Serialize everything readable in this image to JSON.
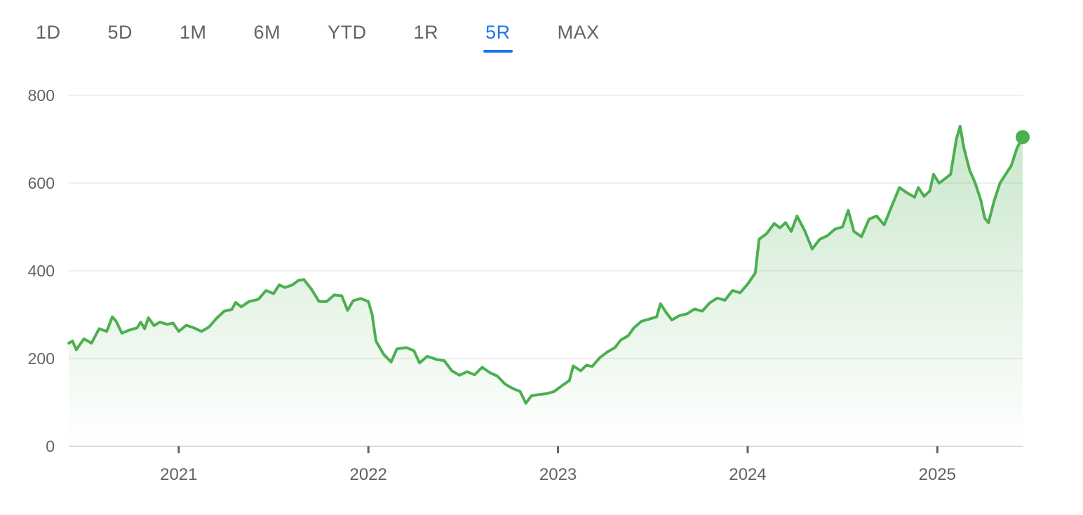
{
  "range_selector": {
    "tabs": [
      {
        "label": "1D",
        "active": false
      },
      {
        "label": "5D",
        "active": false
      },
      {
        "label": "1M",
        "active": false
      },
      {
        "label": "6M",
        "active": false
      },
      {
        "label": "YTD",
        "active": false
      },
      {
        "label": "1R",
        "active": false
      },
      {
        "label": "5R",
        "active": true
      },
      {
        "label": "MAX",
        "active": false
      }
    ],
    "active_color": "#1a73e8",
    "inactive_color": "#5f6368"
  },
  "chart_data": {
    "type": "area",
    "title": "",
    "xlabel": "",
    "ylabel": "",
    "ylim": [
      0,
      800
    ],
    "yticks": [
      0,
      200,
      400,
      600,
      800
    ],
    "xlim": [
      2020.42,
      2025.45
    ],
    "xticks": [
      {
        "value": 2021,
        "label": "2021"
      },
      {
        "value": 2022,
        "label": "2022"
      },
      {
        "value": 2023,
        "label": "2023"
      },
      {
        "value": 2024,
        "label": "2024"
      },
      {
        "value": 2025,
        "label": "2025"
      }
    ],
    "grid": true,
    "line_color": "#4caf50",
    "fill_color": "#4caf50",
    "series": [
      {
        "points": [
          [
            2020.42,
            235
          ],
          [
            2020.44,
            240
          ],
          [
            2020.46,
            220
          ],
          [
            2020.5,
            245
          ],
          [
            2020.54,
            235
          ],
          [
            2020.58,
            268
          ],
          [
            2020.62,
            262
          ],
          [
            2020.65,
            295
          ],
          [
            2020.67,
            285
          ],
          [
            2020.7,
            258
          ],
          [
            2020.74,
            265
          ],
          [
            2020.78,
            270
          ],
          [
            2020.8,
            283
          ],
          [
            2020.82,
            268
          ],
          [
            2020.84,
            293
          ],
          [
            2020.87,
            275
          ],
          [
            2020.9,
            283
          ],
          [
            2020.94,
            278
          ],
          [
            2020.97,
            281
          ],
          [
            2021.0,
            262
          ],
          [
            2021.04,
            276
          ],
          [
            2021.08,
            270
          ],
          [
            2021.12,
            262
          ],
          [
            2021.16,
            272
          ],
          [
            2021.2,
            292
          ],
          [
            2021.24,
            308
          ],
          [
            2021.28,
            312
          ],
          [
            2021.3,
            328
          ],
          [
            2021.33,
            318
          ],
          [
            2021.37,
            330
          ],
          [
            2021.42,
            335
          ],
          [
            2021.46,
            355
          ],
          [
            2021.5,
            348
          ],
          [
            2021.53,
            368
          ],
          [
            2021.56,
            362
          ],
          [
            2021.6,
            368
          ],
          [
            2021.63,
            378
          ],
          [
            2021.66,
            380
          ],
          [
            2021.7,
            358
          ],
          [
            2021.74,
            330
          ],
          [
            2021.78,
            330
          ],
          [
            2021.82,
            345
          ],
          [
            2021.86,
            343
          ],
          [
            2021.89,
            310
          ],
          [
            2021.92,
            332
          ],
          [
            2021.96,
            337
          ],
          [
            2022.0,
            330
          ],
          [
            2022.02,
            300
          ],
          [
            2022.04,
            240
          ],
          [
            2022.08,
            210
          ],
          [
            2022.12,
            192
          ],
          [
            2022.15,
            222
          ],
          [
            2022.2,
            225
          ],
          [
            2022.24,
            218
          ],
          [
            2022.27,
            190
          ],
          [
            2022.31,
            205
          ],
          [
            2022.36,
            198
          ],
          [
            2022.4,
            195
          ],
          [
            2022.44,
            172
          ],
          [
            2022.48,
            162
          ],
          [
            2022.52,
            170
          ],
          [
            2022.56,
            163
          ],
          [
            2022.6,
            180
          ],
          [
            2022.64,
            168
          ],
          [
            2022.68,
            160
          ],
          [
            2022.72,
            142
          ],
          [
            2022.76,
            132
          ],
          [
            2022.8,
            125
          ],
          [
            2022.83,
            98
          ],
          [
            2022.86,
            115
          ],
          [
            2022.9,
            118
          ],
          [
            2022.94,
            120
          ],
          [
            2022.98,
            125
          ],
          [
            2023.02,
            138
          ],
          [
            2023.06,
            150
          ],
          [
            2023.08,
            183
          ],
          [
            2023.12,
            172
          ],
          [
            2023.15,
            185
          ],
          [
            2023.18,
            182
          ],
          [
            2023.22,
            202
          ],
          [
            2023.26,
            215
          ],
          [
            2023.3,
            225
          ],
          [
            2023.33,
            242
          ],
          [
            2023.37,
            252
          ],
          [
            2023.4,
            270
          ],
          [
            2023.44,
            285
          ],
          [
            2023.48,
            290
          ],
          [
            2023.52,
            295
          ],
          [
            2023.54,
            325
          ],
          [
            2023.57,
            305
          ],
          [
            2023.6,
            288
          ],
          [
            2023.64,
            298
          ],
          [
            2023.68,
            302
          ],
          [
            2023.72,
            313
          ],
          [
            2023.76,
            308
          ],
          [
            2023.8,
            327
          ],
          [
            2023.84,
            338
          ],
          [
            2023.88,
            333
          ],
          [
            2023.92,
            355
          ],
          [
            2023.96,
            350
          ],
          [
            2024.0,
            370
          ],
          [
            2024.04,
            395
          ],
          [
            2024.06,
            472
          ],
          [
            2024.1,
            485
          ],
          [
            2024.14,
            508
          ],
          [
            2024.17,
            498
          ],
          [
            2024.2,
            510
          ],
          [
            2024.23,
            490
          ],
          [
            2024.26,
            525
          ],
          [
            2024.3,
            492
          ],
          [
            2024.34,
            450
          ],
          [
            2024.38,
            472
          ],
          [
            2024.42,
            480
          ],
          [
            2024.46,
            495
          ],
          [
            2024.5,
            500
          ],
          [
            2024.53,
            538
          ],
          [
            2024.56,
            490
          ],
          [
            2024.6,
            478
          ],
          [
            2024.64,
            518
          ],
          [
            2024.68,
            525
          ],
          [
            2024.72,
            505
          ],
          [
            2024.76,
            548
          ],
          [
            2024.8,
            590
          ],
          [
            2024.84,
            578
          ],
          [
            2024.88,
            568
          ],
          [
            2024.9,
            590
          ],
          [
            2024.93,
            570
          ],
          [
            2024.96,
            582
          ],
          [
            2024.98,
            620
          ],
          [
            2025.01,
            600
          ],
          [
            2025.04,
            610
          ],
          [
            2025.07,
            620
          ],
          [
            2025.1,
            700
          ],
          [
            2025.12,
            730
          ],
          [
            2025.14,
            680
          ],
          [
            2025.17,
            630
          ],
          [
            2025.2,
            600
          ],
          [
            2025.23,
            560
          ],
          [
            2025.25,
            520
          ],
          [
            2025.27,
            510
          ],
          [
            2025.3,
            560
          ],
          [
            2025.33,
            600
          ],
          [
            2025.36,
            620
          ],
          [
            2025.39,
            640
          ],
          [
            2025.42,
            680
          ],
          [
            2025.45,
            705
          ]
        ]
      }
    ]
  }
}
